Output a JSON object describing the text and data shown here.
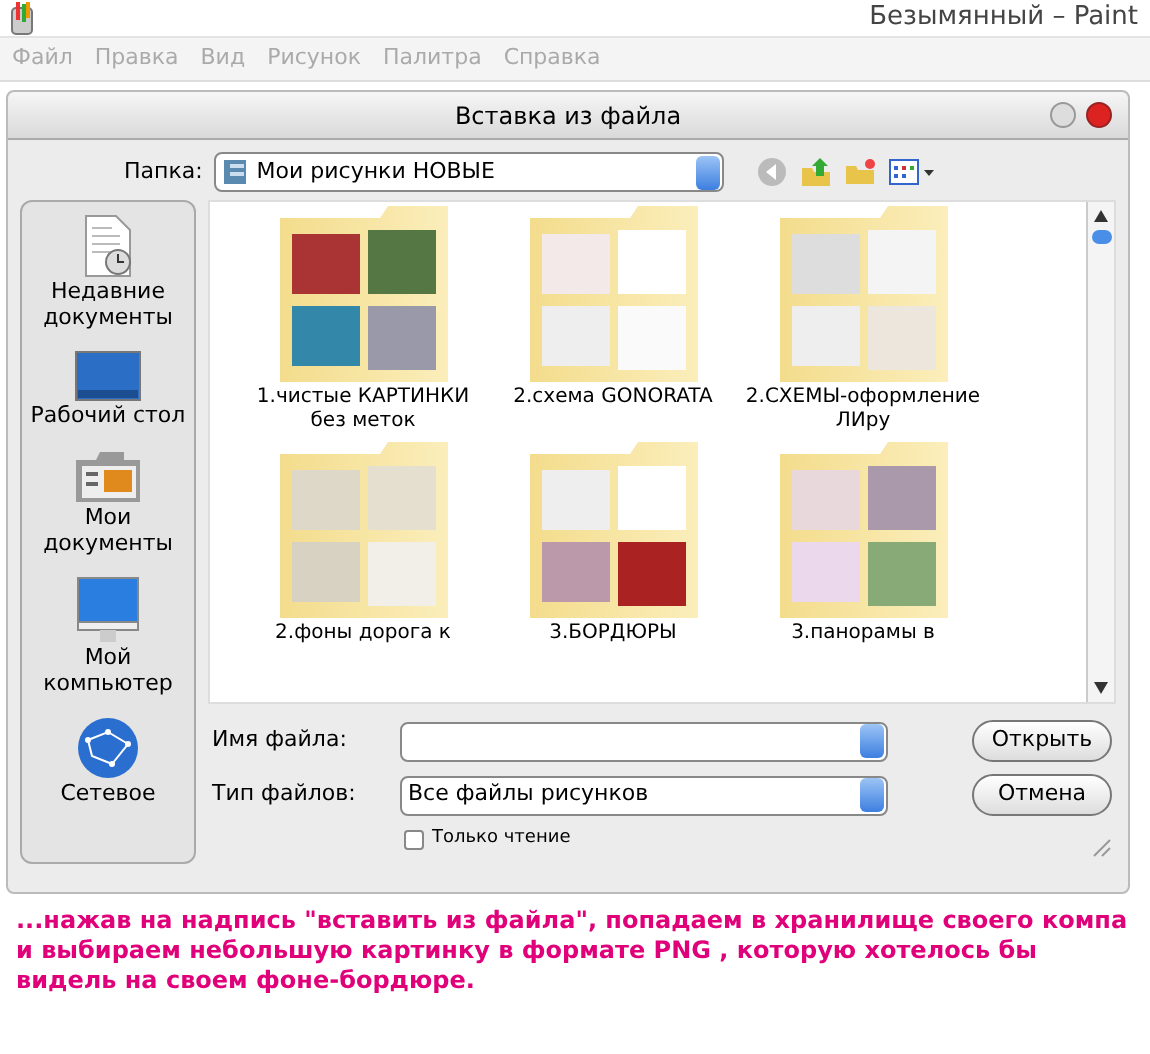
{
  "app": {
    "title": "Безымянный – Paint",
    "menu": [
      {
        "label": "Файл",
        "disabled": true
      },
      {
        "label": "Правка",
        "disabled": true
      },
      {
        "label": "Вид",
        "disabled": true
      },
      {
        "label": "Рисунок",
        "disabled": true
      },
      {
        "label": "Палитра",
        "disabled": true
      },
      {
        "label": "Справка",
        "disabled": true
      }
    ]
  },
  "dialog": {
    "title": "Вставка из файла",
    "folder_label": "Папка:",
    "folder": "Мои рисунки НОВЫЕ",
    "places": [
      {
        "label": "Недавние документы",
        "kind": "recent"
      },
      {
        "label": "Рабочий стол",
        "kind": "desktop"
      },
      {
        "label": "Мои документы",
        "kind": "documents"
      },
      {
        "label": "Мой компьютер",
        "kind": "computer"
      },
      {
        "label": "Сетевое",
        "kind": "network"
      }
    ],
    "files": [
      {
        "name": "1.чистые КАРТИНКИ без меток"
      },
      {
        "name": "2.схема GONORATA"
      },
      {
        "name": "2.СХЕМЫ-оформление ЛИру"
      },
      {
        "name": "2.фоны дорога к"
      },
      {
        "name": "3.БОРДЮРЫ"
      },
      {
        "name": "3.панорамы в"
      }
    ],
    "filename_label": "Имя файла:",
    "filetype_label": "Тип файлов:",
    "filetype": "Все файлы рисунков",
    "readonly": {
      "label": "Только чтение",
      "checked": false
    },
    "buttons": [
      "Открыть",
      "Отмена"
    ]
  },
  "caption": "...нажав на надпись \"вставить из файла\", попадаем в хранилище своего компа и выбираем небольшую картинку в формате PNG , которую хотелось бы видель на своем фоне-бордюре."
}
